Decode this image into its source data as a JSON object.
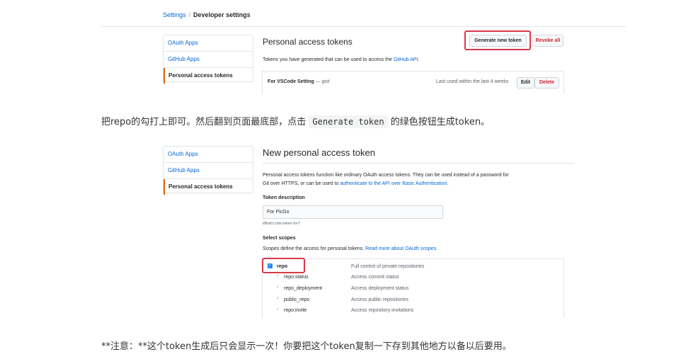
{
  "breadcrumb": {
    "settings": "Settings",
    "separator": "/",
    "current": "Developer settings"
  },
  "menu1": {
    "items": [
      "OAuth Apps",
      "GitHub Apps",
      "Personal access tokens"
    ],
    "active_index": 2
  },
  "tokens_page": {
    "title": "Personal access tokens",
    "generate_button": "Generate new token",
    "revoke_button": "Revoke all",
    "intro_prefix": "Tokens you have generated that can be used to access the",
    "intro_link": "GitHub API",
    "intro_suffix": ".",
    "token_row": {
      "name": "For VSCode Setting",
      "dash": "—",
      "scope": "gist",
      "last_used": "Last used within the last 4 weeks",
      "edit": "Edit",
      "delete": "Delete"
    }
  },
  "instruction": {
    "before": "把repo的勾打上即可。然后翻到页面最底部，点击",
    "code": "Generate token",
    "after": "的绿色按钮生成token。"
  },
  "menu2": {
    "items": [
      "OAuth Apps",
      "GitHub Apps",
      "Personal access tokens"
    ],
    "active_index": 2
  },
  "new_token": {
    "title": "New personal access token",
    "desc_line1": "Personal access tokens function like ordinary OAuth access tokens. They can be used instead of a password for",
    "desc_line2_prefix": "Git over HTTPS, or can be used to",
    "desc_line2_link": "authenticate to the API over Basic Authentication",
    "desc_line2_suffix": ".",
    "token_description_label": "Token description",
    "token_description_value": "For PicGo",
    "hint": "What's this token for?",
    "scopes_label": "Select scopes",
    "scopes_desc_prefix": "Scopes define the access for personal tokens.",
    "scopes_desc_link": "Read more about OAuth scopes.",
    "scopes": [
      {
        "name": "repo",
        "desc": "Full control of private repositories",
        "checked": true
      },
      {
        "name": "repo:status",
        "desc": "Access commit status",
        "checked": true
      },
      {
        "name": "repo_deployment",
        "desc": "Access deployment status",
        "checked": true
      },
      {
        "name": "public_repo",
        "desc": "Access public repositories",
        "checked": true
      },
      {
        "name": "repo:invite",
        "desc": "Access repository invitations",
        "checked": true
      }
    ]
  },
  "note": "**注意：**这个token生成后只会显示一次！你要把这个token复制一下存到其他地方以备以后要用。",
  "colors": {
    "link": "#0366d6",
    "highlight_red": "#d73a49",
    "active_orange": "#e36209",
    "checkbox_blue": "#2188ff"
  }
}
